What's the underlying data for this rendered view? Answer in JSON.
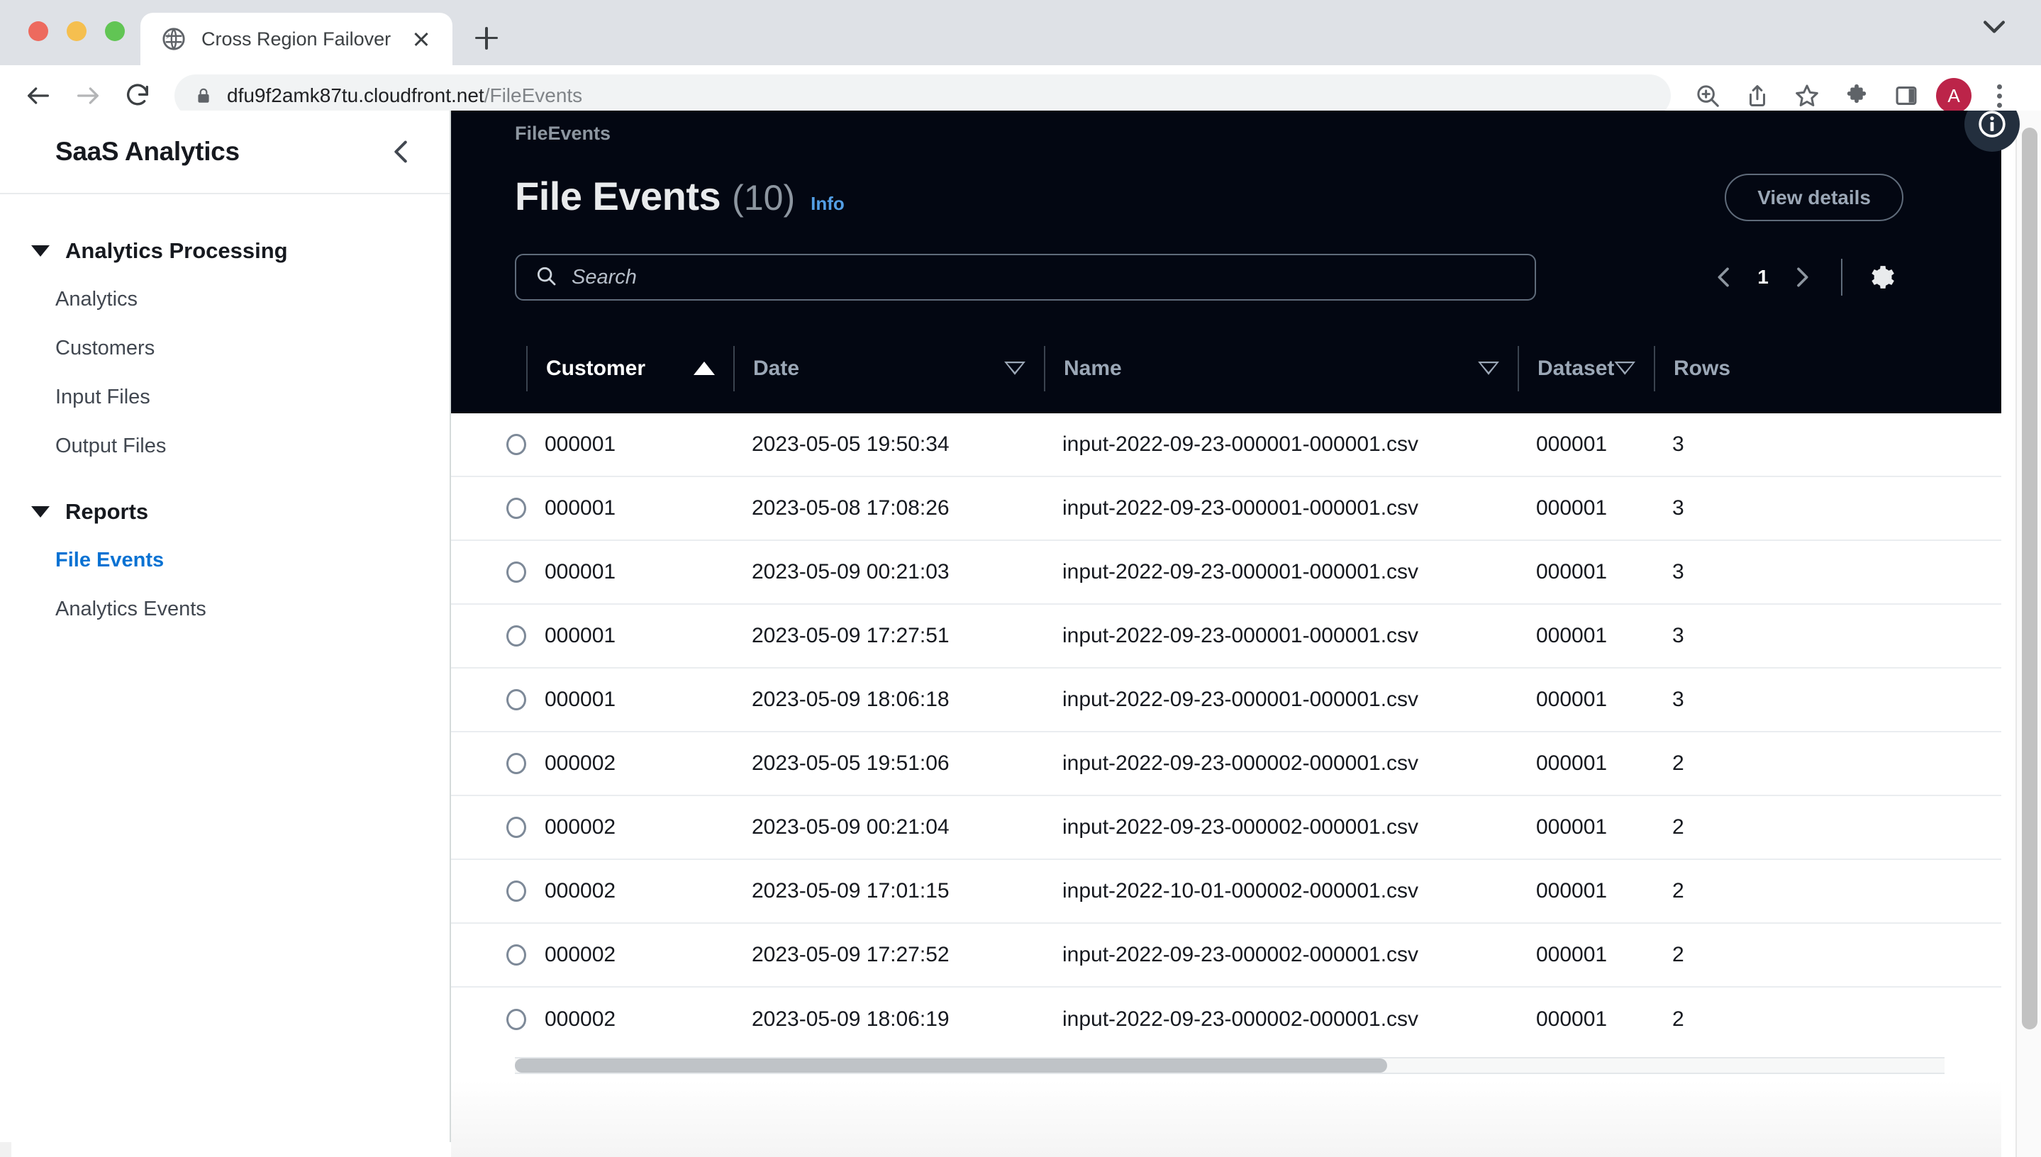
{
  "browser": {
    "tab": {
      "title": "Cross Region Failover",
      "favicon_icon": "globe-icon",
      "close_icon": "close-icon"
    },
    "new_tab_icon": "plus-icon",
    "tab_list_icon": "chevron-down-icon",
    "nav": {
      "back_icon": "arrow-left-icon",
      "forward_icon": "arrow-right-icon",
      "reload_icon": "reload-icon"
    },
    "omnibox": {
      "lock_icon": "lock-icon",
      "url_host": "dfu9f2amk87tu.cloudfront.net",
      "url_path": "/FileEvents"
    },
    "toolbar_icons": [
      "zoom-in-icon",
      "share-icon",
      "bookmark-star-icon",
      "extensions-puzzle-icon",
      "side-panel-icon"
    ],
    "profile": {
      "initial": "A",
      "color": "#bc2449"
    },
    "menu_icon": "kebab-menu-icon"
  },
  "sidebar": {
    "title": "SaaS Analytics",
    "collapse_icon": "chevron-left-icon",
    "groups": [
      {
        "label": "Analytics Processing",
        "caret_icon": "caret-down-icon",
        "items": [
          {
            "label": "Analytics",
            "active": false
          },
          {
            "label": "Customers",
            "active": false
          },
          {
            "label": "Input Files",
            "active": false
          },
          {
            "label": "Output Files",
            "active": false
          }
        ]
      },
      {
        "label": "Reports",
        "caret_icon": "caret-down-icon",
        "items": [
          {
            "label": "File Events",
            "active": true
          },
          {
            "label": "Analytics Events",
            "active": false
          }
        ]
      }
    ],
    "active_color": "#0972d3"
  },
  "header": {
    "breadcrumb": "FileEvents",
    "title": "File Events",
    "count": "(10)",
    "info_label": "Info",
    "view_details_label": "View details",
    "info_fab_icon": "info-circle-icon"
  },
  "search": {
    "placeholder": "Search",
    "value": "",
    "icon": "search-icon"
  },
  "pagination": {
    "prev_icon": "chevron-left-icon",
    "next_icon": "chevron-right-icon",
    "page": "1",
    "settings_icon": "gear-icon"
  },
  "table": {
    "columns": [
      {
        "key": "select",
        "label": "",
        "sort": "none",
        "sort_icon": ""
      },
      {
        "key": "customer",
        "label": "Customer",
        "sort": "ascending",
        "sort_icon": "triangle-up-filled-icon"
      },
      {
        "key": "date",
        "label": "Date",
        "sort": "sortable",
        "sort_icon": "triangle-down-hollow-icon"
      },
      {
        "key": "name",
        "label": "Name",
        "sort": "sortable",
        "sort_icon": "triangle-down-hollow-icon"
      },
      {
        "key": "dataset",
        "label": "Dataset",
        "sort": "sortable",
        "sort_icon": "triangle-down-hollow-icon"
      },
      {
        "key": "rows",
        "label": "Rows",
        "sort": "none",
        "sort_icon": ""
      }
    ],
    "rows": [
      {
        "customer": "000001",
        "date": "2023-05-05 19:50:34",
        "name": "input-2022-09-23-000001-000001.csv",
        "dataset": "000001",
        "rows": "3"
      },
      {
        "customer": "000001",
        "date": "2023-05-08 17:08:26",
        "name": "input-2022-09-23-000001-000001.csv",
        "dataset": "000001",
        "rows": "3"
      },
      {
        "customer": "000001",
        "date": "2023-05-09 00:21:03",
        "name": "input-2022-09-23-000001-000001.csv",
        "dataset": "000001",
        "rows": "3"
      },
      {
        "customer": "000001",
        "date": "2023-05-09 17:27:51",
        "name": "input-2022-09-23-000001-000001.csv",
        "dataset": "000001",
        "rows": "3"
      },
      {
        "customer": "000001",
        "date": "2023-05-09 18:06:18",
        "name": "input-2022-09-23-000001-000001.csv",
        "dataset": "000001",
        "rows": "3"
      },
      {
        "customer": "000002",
        "date": "2023-05-05 19:51:06",
        "name": "input-2022-09-23-000002-000001.csv",
        "dataset": "000001",
        "rows": "2"
      },
      {
        "customer": "000002",
        "date": "2023-05-09 00:21:04",
        "name": "input-2022-09-23-000002-000001.csv",
        "dataset": "000001",
        "rows": "2"
      },
      {
        "customer": "000002",
        "date": "2023-05-09 17:01:15",
        "name": "input-2022-10-01-000002-000001.csv",
        "dataset": "000001",
        "rows": "2"
      },
      {
        "customer": "000002",
        "date": "2023-05-09 17:27:52",
        "name": "input-2022-09-23-000002-000001.csv",
        "dataset": "000001",
        "rows": "2"
      },
      {
        "customer": "000002",
        "date": "2023-05-09 18:06:19",
        "name": "input-2022-09-23-000002-000001.csv",
        "dataset": "000001",
        "rows": "2"
      }
    ]
  },
  "colors": {
    "dark_header": "#030712",
    "accent_blue": "#0972d3",
    "info_blue": "#539fe5"
  }
}
